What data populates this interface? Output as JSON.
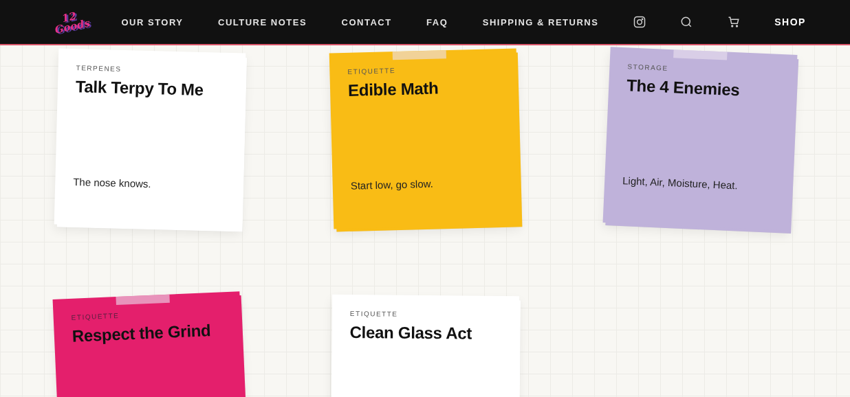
{
  "nav": {
    "logo": "12 Goods",
    "links": [
      "OUR STORY",
      "CULTURE NOTES",
      "CONTACT",
      "FAQ",
      "SHIPPING & RETURNS"
    ],
    "shop": "SHOP"
  },
  "notes": [
    {
      "tag": "TERPENES",
      "title": "Talk Terpy To Me",
      "blurb": "The nose knows.",
      "color": "#ffffff",
      "tape": false
    },
    {
      "tag": "ETIQUETTE",
      "title": "Edible Math",
      "blurb": "Start low, go slow.",
      "color": "#f9bc15",
      "tape": true
    },
    {
      "tag": "STORAGE",
      "title": "The 4 Enemies",
      "blurb": "Light, Air, Moisture, Heat.",
      "color": "#bfb2da",
      "tape": true
    },
    {
      "tag": "ETIQUETTE",
      "title": "Respect the Grind",
      "color": "#e41f6c",
      "tape": true
    },
    {
      "tag": "ETIQUETTE",
      "title": "Clean Glass Act",
      "color": "#ffffff",
      "tape": false
    }
  ]
}
